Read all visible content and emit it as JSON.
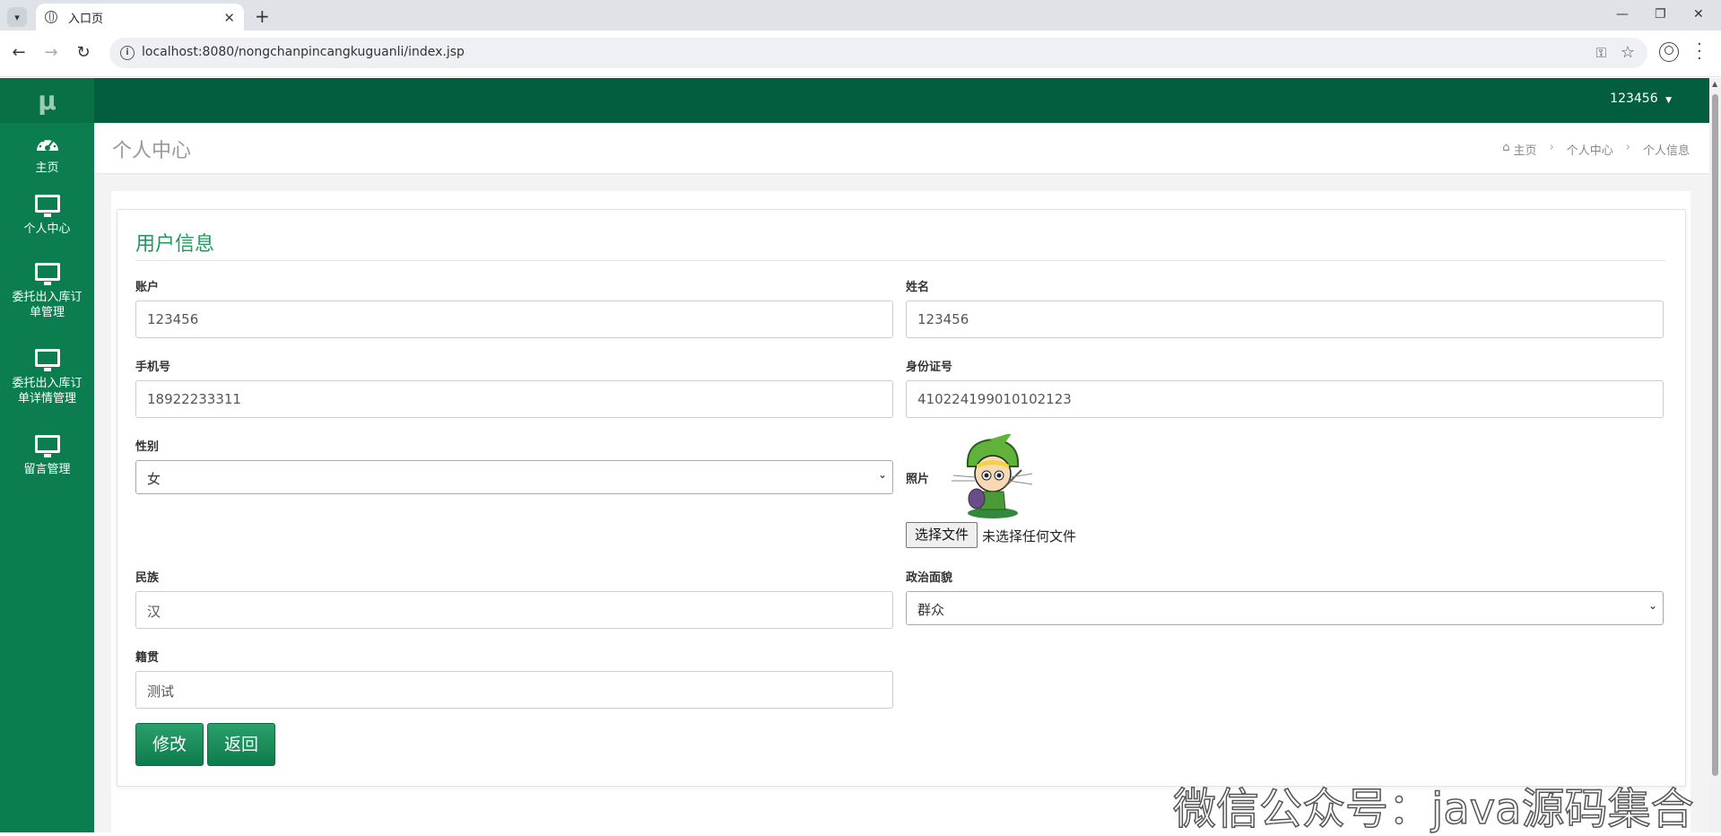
{
  "browser": {
    "tab_title": "入口页",
    "url": "localhost:8080/nongchanpincangkuguanli/index.jsp",
    "icons": [
      "tab-list-icon",
      "globe-icon",
      "close-icon",
      "new-tab-icon",
      "minimize-icon",
      "restore-icon",
      "back-icon",
      "forward-icon",
      "reload-icon",
      "info-icon",
      "key-icon",
      "star-icon",
      "profile-icon",
      "menu-icon"
    ]
  },
  "sidebar": {
    "logo": "μ",
    "items": [
      {
        "label": "主页",
        "icon": "dashboard-icon"
      },
      {
        "label": "个人中心",
        "icon": "monitor-icon"
      },
      {
        "label": "委托出入库订单管理",
        "icon": "monitor-icon"
      },
      {
        "label": "委托出入库订单详情管理",
        "icon": "monitor-icon"
      },
      {
        "label": "留言管理",
        "icon": "monitor-icon"
      }
    ]
  },
  "topbar": {
    "user": "123456"
  },
  "page": {
    "title": "个人中心",
    "breadcrumb": [
      "主页",
      "个人中心",
      "个人信息"
    ]
  },
  "form": {
    "title": "用户信息",
    "account_label": "账户",
    "account_value": "123456",
    "name_label": "姓名",
    "name_value": "123456",
    "phone_label": "手机号",
    "phone_value": "18922233311",
    "id_label": "身份证号",
    "id_value": "410224199010102123",
    "gender_label": "性别",
    "gender_value": "女",
    "photo_label": "照片",
    "file_button": "选择文件",
    "file_status": "未选择任何文件",
    "ethnic_label": "民族",
    "ethnic_value": "汉",
    "politics_label": "政治面貌",
    "politics_value": "群众",
    "origin_label": "籍贯",
    "origin_value": "测试",
    "submit": "修改",
    "back": "返回"
  },
  "watermark": "微信公众号：java源码集合",
  "colors": {
    "sidebar": "#0b7d4e",
    "topbar": "#025e3e",
    "accent": "#1f9a5d"
  }
}
